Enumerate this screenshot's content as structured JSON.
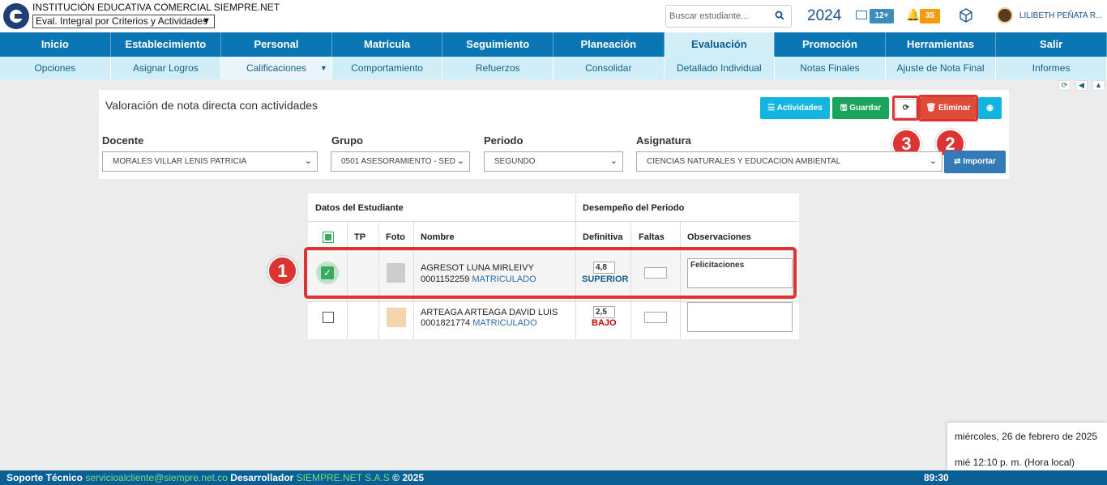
{
  "header": {
    "institution": "INSTITUCIÓN EDUCATIVA COMERCIAL SIEMPRE.NET",
    "mode": "Eval. Integral por Criterios y Actividades",
    "search_placeholder": "Buscar estudiante...",
    "year": "2024",
    "mail_count": "12+",
    "notification_count": "35",
    "user": "LILIBETH PEÑATA R..."
  },
  "nav": {
    "main": [
      "Inicio",
      "Establecimiento",
      "Personal",
      "Matrícula",
      "Seguimiento",
      "Planeación",
      "Evaluación",
      "Promoción",
      "Herramientas",
      "Salir"
    ],
    "sub": [
      "Opciones",
      "Asignar Logros",
      "Calificaciones",
      "Comportamiento",
      "Refuerzos",
      "Consolidar",
      "Detallado Individual",
      "Notas Finales",
      "Ajuste de Nota Final",
      "Informes"
    ]
  },
  "panel": {
    "title": "Valoración de nota directa con actividades",
    "buttons": {
      "actividades": "Actividades",
      "guardar": "Guardar",
      "eliminar": "Eliminar",
      "importar": "Importar"
    },
    "fields": {
      "docente_label": "Docente",
      "docente_value": "MORALES VILLAR LENIS PATRICIA",
      "grupo_label": "Grupo",
      "grupo_value": "0501 ASESORAMIENTO - SED",
      "periodo_label": "Periodo",
      "periodo_value": "SEGUNDO",
      "asignatura_label": "Asignatura",
      "asignatura_value": "CIENCIAS NATURALES Y EDUCACION AMBIENTAL"
    }
  },
  "markers": [
    "1",
    "2",
    "3"
  ],
  "table": {
    "group_headers": [
      "Datos del Estudiante",
      "Desempeño del Periodo"
    ],
    "columns": [
      "TP",
      "Foto",
      "Nombre",
      "Definitiva",
      "Faltas",
      "Observaciones"
    ],
    "rows": [
      {
        "name": "AGRESOT LUNA MIRLEIVY",
        "code": "0001152259",
        "status": "MATRICULADO",
        "grade": "4,8",
        "level": "SUPERIOR",
        "level_color": "#135f8a",
        "observation": "Felicitaciones"
      },
      {
        "name": "ARTEAGA ARTEAGA DAVID LUIS",
        "code": "0001821774",
        "status": "MATRICULADO",
        "grade": "2,5",
        "level": "BAJO",
        "level_color": "#cc0000",
        "observation": ""
      }
    ]
  },
  "footer": {
    "support_label": "Soporte Técnico",
    "support_email": "servicioalcliente@siempre.net.co",
    "dev_label": "Desarrollador",
    "dev_name": "SIEMPRE.NET S.A.S",
    "copyright": "© 2025",
    "timer": "89:30"
  },
  "clock": {
    "date": "miércoles, 26 de febrero de 2025",
    "time": "mié 12:10 p. m. (Hora local)"
  }
}
